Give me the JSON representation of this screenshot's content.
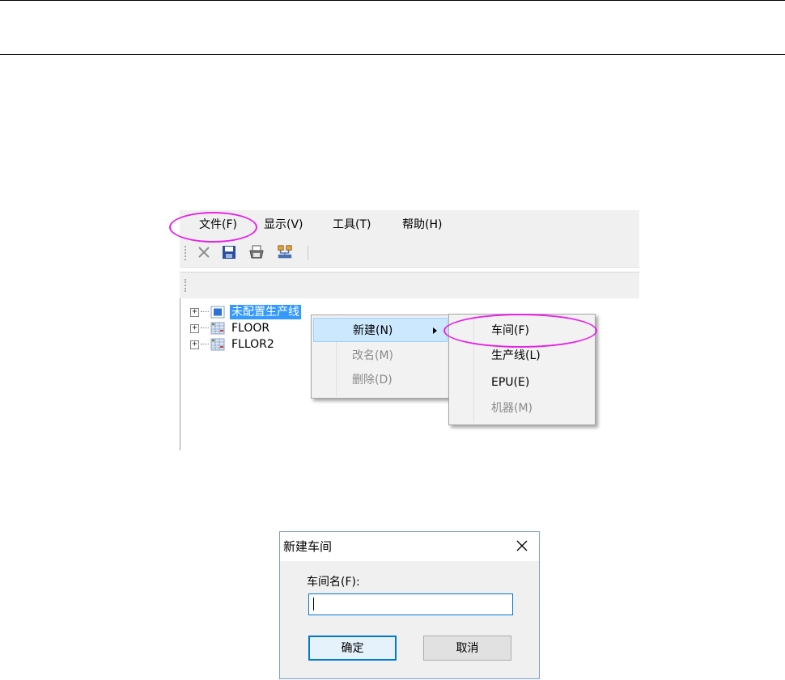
{
  "menubar": {
    "items": [
      {
        "label": "文件(F)"
      },
      {
        "label": "显示(V)"
      },
      {
        "label": "工具(T)"
      },
      {
        "label": "帮助(H)"
      }
    ]
  },
  "toolbar": {
    "icons": [
      "delete-x-icon",
      "save-disk-icon",
      "print-icon",
      "network-icon"
    ]
  },
  "tree": {
    "nodes": [
      {
        "label": "未配置生产线",
        "selected": true
      },
      {
        "label": "FLOOR"
      },
      {
        "label": "FLLOR2"
      }
    ]
  },
  "context_menu": {
    "items": [
      {
        "label": "新建(N)",
        "has_submenu": true,
        "highlighted": true
      },
      {
        "label": "改名(M)",
        "disabled": true
      },
      {
        "label": "删除(D)",
        "disabled": true
      }
    ]
  },
  "submenu": {
    "items": [
      {
        "label": "车间(F)"
      },
      {
        "label": "生产线(L)"
      },
      {
        "label": "EPU(E)"
      },
      {
        "label": "机器(M)",
        "disabled": true
      }
    ]
  },
  "dialog": {
    "title": "新建车间",
    "field_label": "车间名(F):",
    "field_value": "",
    "ok_label": "确定",
    "cancel_label": "取消"
  },
  "colors": {
    "highlight_ellipse": "#e623e6",
    "selection": "#3399ff",
    "menu_hover": "#cce8ff"
  }
}
